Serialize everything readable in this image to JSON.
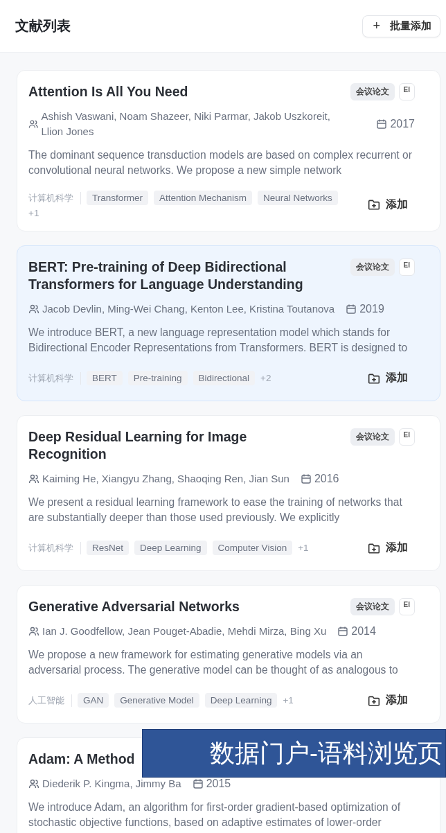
{
  "header": {
    "title": "文献列表",
    "action": {
      "icon": "+",
      "label": "批量添加"
    }
  },
  "papers": [
    {
      "title": "Attention Is All You Need",
      "type_badge": "会议论文",
      "index_badge": "EI",
      "authors": "Ashish Vaswani, Noam Shazeer, Niki Parmar, Jakob Uszkoreit, Llion Jones",
      "year": "2017",
      "abstract": "The dominant sequence transduction models are based on complex recurrent or convolutional neural networks. We propose a new simple network",
      "category": "计算机科学",
      "tags": [
        "Transformer",
        "Attention Mechanism",
        "Neural Networks"
      ],
      "more": "+1",
      "add_label": "添加",
      "selected": false
    },
    {
      "title": "BERT: Pre-training of Deep Bidirectional Transformers for Language Understanding",
      "type_badge": "会议论文",
      "index_badge": "EI",
      "authors": "Jacob Devlin, Ming-Wei Chang, Kenton Lee, Kristina Toutanova",
      "year": "2019",
      "abstract": "We introduce BERT, a new language representation model which stands for Bidirectional Encoder Representations from Transformers. BERT is designed to",
      "category": "计算机科学",
      "tags": [
        "BERT",
        "Pre-training",
        "Bidirectional"
      ],
      "more": "+2",
      "add_label": "添加",
      "selected": true
    },
    {
      "title": "Deep Residual Learning for Image Recognition",
      "type_badge": "会议论文",
      "index_badge": "EI",
      "authors": "Kaiming He, Xiangyu Zhang, Shaoqing Ren, Jian Sun",
      "year": "2016",
      "abstract": "We present a residual learning framework to ease the training of networks that are substantially deeper than those used previously. We explicitly",
      "category": "计算机科学",
      "tags": [
        "ResNet",
        "Deep Learning",
        "Computer Vision"
      ],
      "more": "+1",
      "add_label": "添加",
      "selected": false
    },
    {
      "title": "Generative Adversarial Networks",
      "type_badge": "会议论文",
      "index_badge": "EI",
      "authors": "Ian J. Goodfellow, Jean Pouget-Abadie, Mehdi Mirza, Bing Xu",
      "year": "2014",
      "abstract": "We propose a new framework for estimating generative models via an adversarial process. The generative model can be thought of as analogous to",
      "category": "人工智能",
      "tags": [
        "GAN",
        "Generative Model",
        "Deep Learning"
      ],
      "more": "+1",
      "add_label": "添加",
      "selected": false
    },
    {
      "title": "Adam: A Method",
      "authors": "Diederik P. Kingma, Jimmy Ba",
      "year": "2015",
      "abstract": "We introduce Adam, an algorithm for first-order gradient-based optimization of stochastic objective functions, based on adaptive estimates of lower-order",
      "selected": false
    }
  ],
  "caption_banner": "数据门户-语料浏览页"
}
